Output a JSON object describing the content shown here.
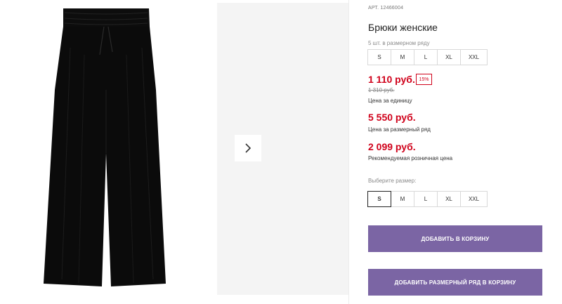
{
  "product": {
    "article": "АРТ. 12466004",
    "title": "Брюки женские",
    "row_note": "5 шт. в размерном ряду",
    "row_sizes": [
      "S",
      "M",
      "L",
      "XL",
      "XXL"
    ]
  },
  "pricing": {
    "unit_price": "1 110 руб.",
    "discount": "15%",
    "old_price": "1 310 руб.",
    "unit_label": "Цена за единицу",
    "row_price": "5 550 руб.",
    "row_label": "Цена за размерный ряд",
    "rrp_price": "2 099 руб.",
    "rrp_label": "Рекомендуемая розничная цена"
  },
  "size_picker": {
    "label": "Выберите размер:",
    "options": [
      "S",
      "M",
      "L",
      "XL",
      "XXL"
    ],
    "selected": "S"
  },
  "actions": {
    "add_to_cart": "ДОБАВИТЬ В КОРЗИНУ",
    "add_row_to_cart": "ДОБАВИТЬ РАЗМЕРНЫЙ РЯД В КОРЗИНУ"
  },
  "gallery": {
    "next_icon": "chevron-right-icon"
  },
  "colors": {
    "accent": "#7b65a4",
    "price": "#d0021b"
  }
}
